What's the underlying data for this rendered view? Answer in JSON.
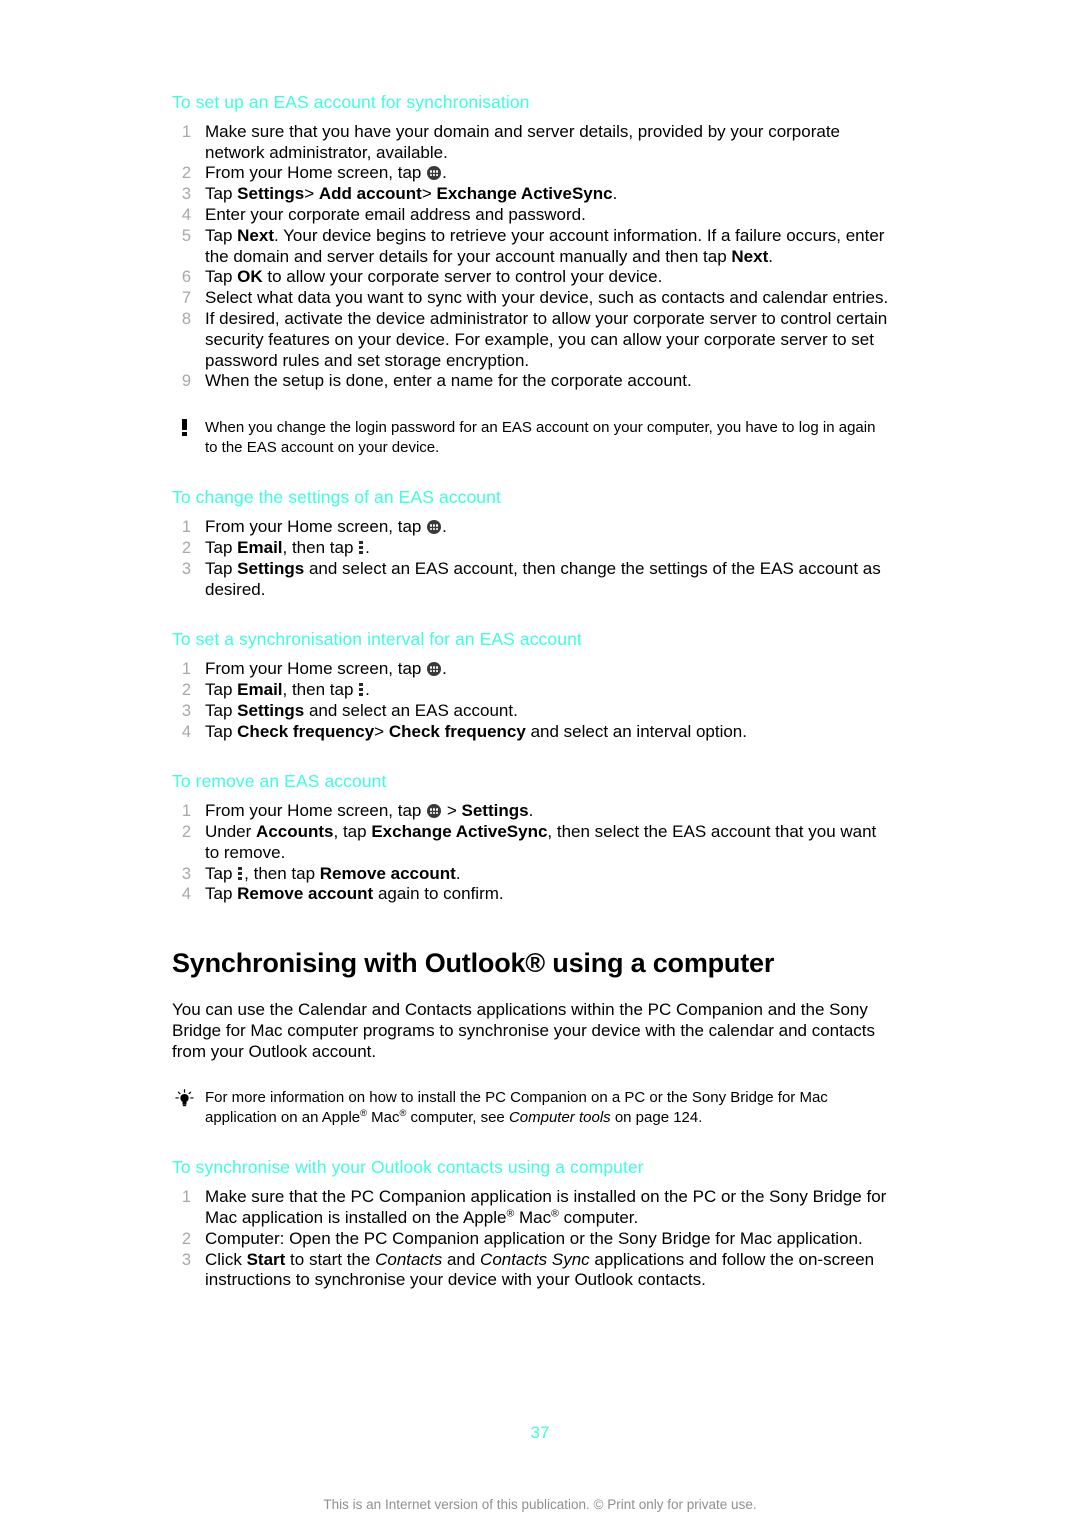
{
  "document": {
    "page_number": "37",
    "footer_note": "This is an Internet version of this publication. © Print only for private use.",
    "heading_color": "#3cffdf"
  },
  "sections": {
    "eas_setup": {
      "heading": "To set up an EAS account for synchronisation",
      "steps": [
        "Make sure that you have your domain and server details, provided by your corporate network administrator, available.",
        "From your Home screen, tap .",
        "Tap Settings > Add account > Exchange ActiveSync.",
        "Enter your corporate email address and password.",
        "Tap Next. Your device begins to retrieve your account information. If a failure occurs, enter the domain and server details for your account manually and then tap Next.",
        "Tap OK to allow your corporate server to control your device.",
        "Select what data you want to sync with your device, such as contacts and calendar entries.",
        "If desired, activate the device administrator to allow your corporate server to control certain security features on your device. For example, you can allow your corporate server to set password rules and set storage encryption.",
        "When the setup is done, enter a name for the corporate account."
      ],
      "note": "When you change the login password for an EAS account on your computer, you have to log in again to the EAS account on your device.",
      "note_icon": "exclamation-icon"
    },
    "eas_change_settings": {
      "heading": "To change the settings of an EAS account",
      "steps": [
        "From your Home screen, tap .",
        "Tap Email, then tap .",
        "Tap Settings and select an EAS account, then change the settings of the EAS account as desired."
      ]
    },
    "eas_sync_interval": {
      "heading": "To set a synchronisation interval for an EAS account",
      "steps": [
        "From your Home screen, tap .",
        "Tap Email, then tap .",
        "Tap Settings and select an EAS account.",
        "Tap Check frequency > Check frequency and select an interval option."
      ]
    },
    "eas_remove": {
      "heading": "To remove an EAS account",
      "steps": [
        "From your Home screen, tap  > Settings.",
        "Under Accounts, tap Exchange ActiveSync, then select the EAS account that you want to remove.",
        "Tap , then tap Remove account.",
        "Tap Remove account again to confirm."
      ]
    },
    "outlook": {
      "heading": "Synchronising with Outlook® using a computer",
      "body": "You can use the Calendar and Contacts applications within the PC Companion and the Sony Bridge for Mac computer programs to synchronise your device with the calendar and contacts from your Outlook account.",
      "tip": "For more information on how to install the PC Companion on a PC or the Sony Bridge for Mac application on an Apple® Mac® computer, see Computer tools on page 124.",
      "tip_icon": "lightbulb-icon",
      "tip_reference": "Computer tools",
      "tip_page": "124"
    },
    "outlook_contacts_sync": {
      "heading": "To synchronise with your Outlook contacts using a computer",
      "steps": [
        "Make sure that the PC Companion application is installed on the PC or the Sony Bridge for Mac application is installed on the Apple® Mac® computer.",
        "Computer: Open the PC Companion application or the Sony Bridge for Mac application.",
        "Click Start to start the Contacts and Contacts Sync applications and follow the on-screen instructions to synchronise your device with your Outlook contacts."
      ]
    }
  },
  "text_fragments": {
    "eas_setup": {
      "s1": "Make sure that you have your domain and server details, provided by your corporate network administrator, available.",
      "s2_a": "From your Home screen, tap",
      "s2_b": ".",
      "s3_a": "Tap",
      "s3_b": "Settings",
      "s3_c": ">",
      "s3_d": "Add account",
      "s3_e": ">",
      "s3_f": "Exchange ActiveSync",
      "s3_g": ".",
      "s4": "Enter your corporate email address and password.",
      "s5_a": "Tap",
      "s5_b": "Next",
      "s5_c": ". Your device begins to retrieve your account information. If a failure occurs, enter the domain and server details for your account manually and then tap",
      "s5_d": "Next",
      "s5_e": ".",
      "s6_a": "Tap",
      "s6_b": "OK",
      "s6_c": "to allow your corporate server to control your device.",
      "s7": "Select what data you want to sync with your device, such as contacts and calendar entries.",
      "s8": "If desired, activate the device administrator to allow your corporate server to control certain security features on your device. For example, you can allow your corporate server to set password rules and set storage encryption.",
      "s9": "When the setup is done, enter a name for the corporate account."
    },
    "eas_change": {
      "s1_a": "From your Home screen, tap",
      "s1_b": ".",
      "s2_a": "Tap",
      "s2_b": "Email",
      "s2_c": ", then tap",
      "s2_d": ".",
      "s3_a": "Tap",
      "s3_b": "Settings",
      "s3_c": "and select an EAS account, then change the settings of the EAS account as desired."
    },
    "eas_interval": {
      "s1_a": "From your Home screen, tap",
      "s1_b": ".",
      "s2_a": "Tap",
      "s2_b": "Email",
      "s2_c": ", then tap",
      "s2_d": ".",
      "s3_a": "Tap",
      "s3_b": "Settings",
      "s3_c": "and select an EAS account.",
      "s4_a": "Tap",
      "s4_b": "Check frequency",
      "s4_c": ">",
      "s4_d": "Check frequency",
      "s4_e": "and select an interval option."
    },
    "eas_remove": {
      "s1_a": "From your Home screen, tap",
      "s1_b": ">",
      "s1_c": "Settings",
      "s1_d": ".",
      "s2_a": "Under",
      "s2_b": "Accounts",
      "s2_c": ", tap",
      "s2_d": "Exchange ActiveSync",
      "s2_e": ", then select the EAS account that you want to remove.",
      "s3_a": "Tap",
      "s3_b": ", then tap",
      "s3_c": "Remove account",
      "s3_d": ".",
      "s4_a": "Tap",
      "s4_b": "Remove account",
      "s4_c": "again to confirm."
    },
    "outlook_tip": {
      "a": "For more information on how to install the PC Companion on a PC or the Sony Bridge for Mac application on an Apple",
      "b": "®",
      "c": "Mac",
      "d": "®",
      "e": "computer, see",
      "f": "Computer tools",
      "g": "on page 124."
    },
    "outlook_steps": {
      "s1_a": "Make sure that the PC Companion application is installed on the PC or the Sony Bridge for Mac application is installed on the Apple",
      "s1_b": "®",
      "s1_c": "Mac",
      "s1_d": "®",
      "s1_e": "computer.",
      "s2": "Computer: Open the PC Companion application or the Sony Bridge for Mac application.",
      "s3_a": "Click",
      "s3_b": "Start",
      "s3_c": "to start the",
      "s3_d": "Contacts",
      "s3_e": "and",
      "s3_f": "Contacts Sync",
      "s3_g": "applications and follow the on-screen instructions to synchronise your device with your Outlook contacts."
    }
  }
}
